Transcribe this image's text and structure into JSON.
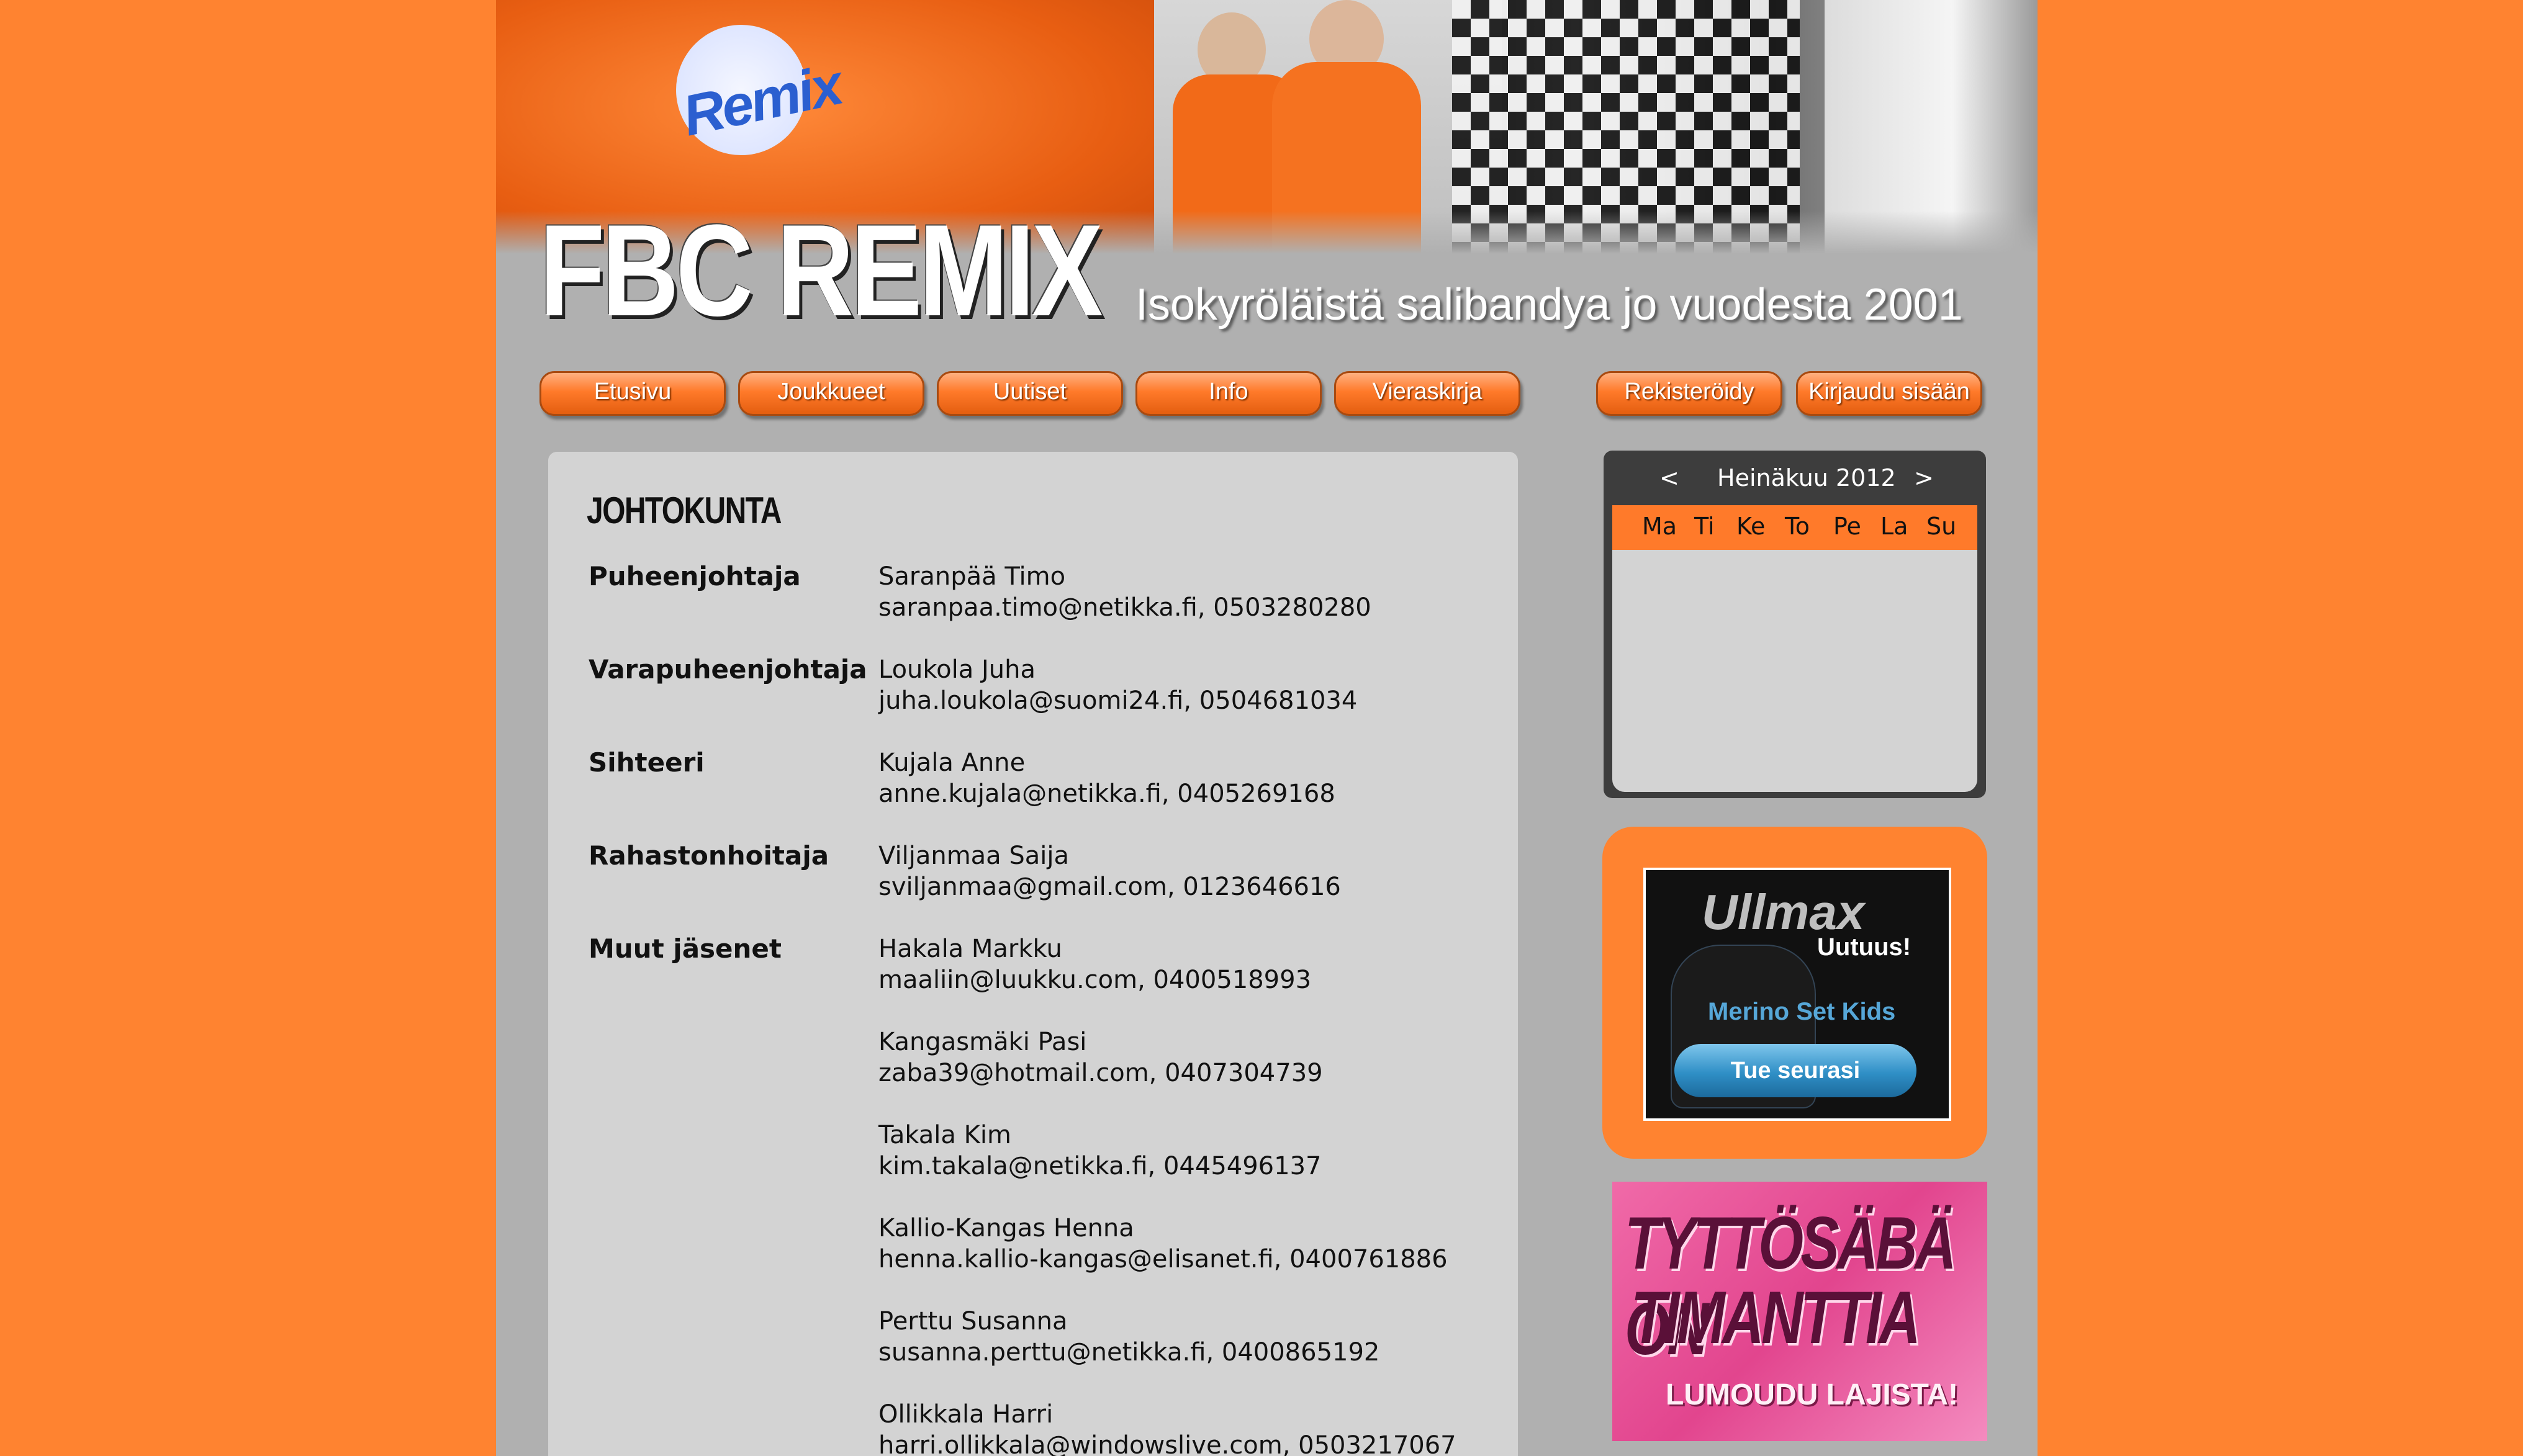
{
  "header": {
    "logo_text": "FBC REMIX",
    "badge_text": "Remix",
    "tagline": "Isokyröläistä salibandya jo vuodesta 2001"
  },
  "nav": {
    "items": [
      {
        "label": "Etusivu"
      },
      {
        "label": "Joukkueet"
      },
      {
        "label": "Uutiset"
      },
      {
        "label": "Info"
      },
      {
        "label": "Vieraskirja"
      }
    ],
    "register_label": "Rekisteröidy",
    "login_label": "Kirjaudu sisään"
  },
  "content": {
    "title": "JOHTOKUNTA",
    "groups": [
      {
        "role": "Puheenjohtaja",
        "people": [
          {
            "name": "Saranpää Timo",
            "contact": "saranpaa.timo@netikka.fi, 0503280280"
          }
        ]
      },
      {
        "role": "Varapuheenjohtaja",
        "people": [
          {
            "name": "Loukola Juha",
            "contact": "juha.loukola@suomi24.fi, 0504681034"
          }
        ]
      },
      {
        "role": "Sihteeri",
        "people": [
          {
            "name": "Kujala Anne",
            "contact": "anne.kujala@netikka.fi, 0405269168"
          }
        ]
      },
      {
        "role": "Rahastonhoitaja",
        "people": [
          {
            "name": "Viljanmaa Saija",
            "contact": "sviljanmaa@gmail.com, 0123646616"
          }
        ]
      },
      {
        "role": "Muut jäsenet",
        "people": [
          {
            "name": "Hakala Markku",
            "contact": "maaliin@luukku.com, 0400518993"
          },
          {
            "name": "Kangasmäki Pasi",
            "contact": "zaba39@hotmail.com, 0407304739"
          },
          {
            "name": "Takala Kim",
            "contact": "kim.takala@netikka.fi, 0445496137"
          },
          {
            "name": "Kallio-Kangas Henna",
            "contact": "henna.kallio-kangas@elisanet.fi, 0400761886"
          },
          {
            "name": "Perttu Susanna",
            "contact": "susanna.perttu@netikka.fi, 0400865192"
          },
          {
            "name": "Ollikkala Harri",
            "contact": "harri.ollikkala@windowslive.com, 0503217067"
          }
        ]
      }
    ]
  },
  "calendar": {
    "prev": "<",
    "next": ">",
    "month": "Heinäkuu 2012",
    "days": [
      "Ma",
      "Ti",
      "Ke",
      "To",
      "Pe",
      "La",
      "Su"
    ]
  },
  "ads": {
    "ullmax": {
      "brand": "Ullmax",
      "badge": "Uutuus!",
      "product": "Merino Set Kids",
      "button": "Tue seurasi"
    },
    "tyttosaba": {
      "line1": "TYTTÖSÄBÄ ON",
      "line2": "TIMANTTIA",
      "line3": "LUMOUDU LAJISTA!"
    }
  }
}
